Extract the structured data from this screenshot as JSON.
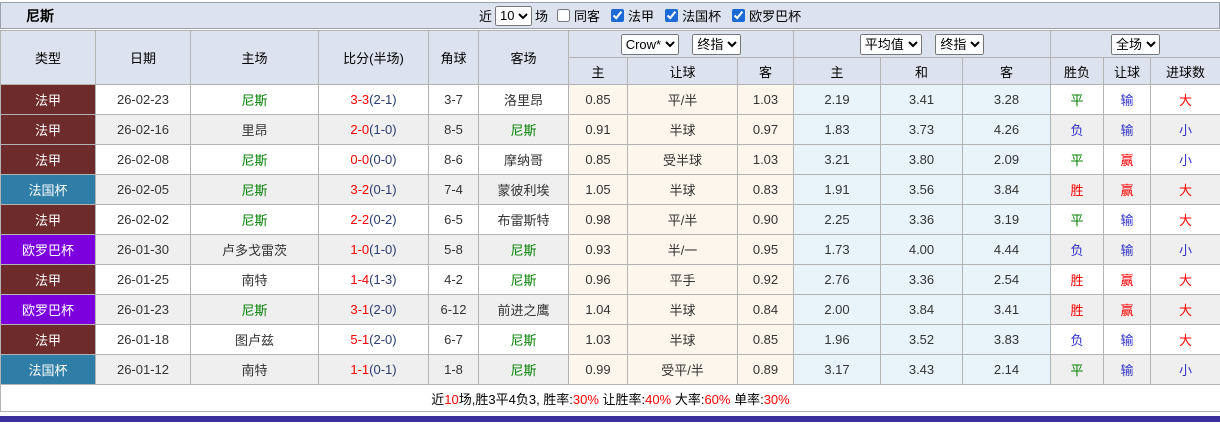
{
  "title": "尼斯",
  "toolbar": {
    "near_label": "近",
    "count_select": "10",
    "unit_label": "场",
    "same_away_label": "同客",
    "filters": [
      {
        "label": "法甲",
        "checked": true
      },
      {
        "label": "法国杯",
        "checked": true
      },
      {
        "label": "欧罗巴杯",
        "checked": true
      }
    ]
  },
  "header": {
    "cols": [
      "类型",
      "日期",
      "主场",
      "比分(半场)",
      "角球",
      "客场"
    ],
    "odds1": {
      "select1": "Crow*",
      "select2": "终指"
    },
    "odds2": {
      "select1": "平均值",
      "select2": "终指"
    },
    "scope_select": "全场",
    "sub": [
      "主",
      "让球",
      "客",
      "主",
      "和",
      "客",
      "胜负",
      "让球",
      "进球数"
    ]
  },
  "rows": [
    {
      "league": "法甲",
      "date": "26-02-23",
      "home": "尼斯",
      "score": "3-3",
      "half": "(2-1)",
      "corner": "3-7",
      "away": "洛里昂",
      "crow_home": "0.85",
      "crow_hcp": "平/半",
      "crow_away": "1.03",
      "avg_home": "2.19",
      "avg_draw": "3.41",
      "avg_away": "3.28",
      "result": "平",
      "hcp_result": "输",
      "goals": "大"
    },
    {
      "league": "法甲",
      "date": "26-02-16",
      "home": "里昂",
      "score": "2-0",
      "half": "(1-0)",
      "corner": "8-5",
      "away": "尼斯",
      "crow_home": "0.91",
      "crow_hcp": "半球",
      "crow_away": "0.97",
      "avg_home": "1.83",
      "avg_draw": "3.73",
      "avg_away": "4.26",
      "result": "负",
      "hcp_result": "输",
      "goals": "小"
    },
    {
      "league": "法甲",
      "date": "26-02-08",
      "home": "尼斯",
      "score": "0-0",
      "half": "(0-0)",
      "corner": "8-6",
      "away": "摩纳哥",
      "crow_home": "0.85",
      "crow_hcp": "受半球",
      "crow_away": "1.03",
      "avg_home": "3.21",
      "avg_draw": "3.80",
      "avg_away": "2.09",
      "result": "平",
      "hcp_result": "赢",
      "goals": "小"
    },
    {
      "league": "法国杯",
      "date": "26-02-05",
      "home": "尼斯",
      "score": "3-2",
      "half": "(0-1)",
      "corner": "7-4",
      "away": "蒙彼利埃",
      "crow_home": "1.05",
      "crow_hcp": "半球",
      "crow_away": "0.83",
      "avg_home": "1.91",
      "avg_draw": "3.56",
      "avg_away": "3.84",
      "result": "胜",
      "hcp_result": "赢",
      "goals": "大"
    },
    {
      "league": "法甲",
      "date": "26-02-02",
      "home": "尼斯",
      "score": "2-2",
      "half": "(0-2)",
      "corner": "6-5",
      "away": "布雷斯特",
      "crow_home": "0.98",
      "crow_hcp": "平/半",
      "crow_away": "0.90",
      "avg_home": "2.25",
      "avg_draw": "3.36",
      "avg_away": "3.19",
      "result": "平",
      "hcp_result": "输",
      "goals": "大"
    },
    {
      "league": "欧罗巴杯",
      "date": "26-01-30",
      "home": "卢多戈雷茨",
      "score": "1-0",
      "half": "(1-0)",
      "corner": "5-8",
      "away": "尼斯",
      "crow_home": "0.93",
      "crow_hcp": "半/一",
      "crow_away": "0.95",
      "avg_home": "1.73",
      "avg_draw": "4.00",
      "avg_away": "4.44",
      "result": "负",
      "hcp_result": "输",
      "goals": "小"
    },
    {
      "league": "法甲",
      "date": "26-01-25",
      "home": "南特",
      "score": "1-4",
      "half": "(1-3)",
      "corner": "4-2",
      "away": "尼斯",
      "crow_home": "0.96",
      "crow_hcp": "平手",
      "crow_away": "0.92",
      "avg_home": "2.76",
      "avg_draw": "3.36",
      "avg_away": "2.54",
      "result": "胜",
      "hcp_result": "赢",
      "goals": "大"
    },
    {
      "league": "欧罗巴杯",
      "date": "26-01-23",
      "home": "尼斯",
      "score": "3-1",
      "half": "(2-0)",
      "corner": "6-12",
      "away": "前进之鹰",
      "crow_home": "1.04",
      "crow_hcp": "半球",
      "crow_away": "0.84",
      "avg_home": "2.00",
      "avg_draw": "3.84",
      "avg_away": "3.41",
      "result": "胜",
      "hcp_result": "赢",
      "goals": "大"
    },
    {
      "league": "法甲",
      "date": "26-01-18",
      "home": "图卢兹",
      "score": "5-1",
      "half": "(2-0)",
      "corner": "6-7",
      "away": "尼斯",
      "crow_home": "1.03",
      "crow_hcp": "半球",
      "crow_away": "0.85",
      "avg_home": "1.96",
      "avg_draw": "3.52",
      "avg_away": "3.83",
      "result": "负",
      "hcp_result": "输",
      "goals": "大"
    },
    {
      "league": "法国杯",
      "date": "26-01-12",
      "home": "南特",
      "score": "1-1",
      "half": "(0-1)",
      "corner": "1-8",
      "away": "尼斯",
      "crow_home": "0.99",
      "crow_hcp": "受平/半",
      "crow_away": "0.89",
      "avg_home": "3.17",
      "avg_draw": "3.43",
      "avg_away": "2.14",
      "result": "平",
      "hcp_result": "输",
      "goals": "小"
    }
  ],
  "summary": {
    "segments": [
      {
        "text": "近",
        "color": "black"
      },
      {
        "text": "10",
        "color": "red"
      },
      {
        "text": "场,胜3平4负3, 胜率:",
        "color": "black"
      },
      {
        "text": "30%",
        "color": "red"
      },
      {
        "text": " 让胜率:",
        "color": "black"
      },
      {
        "text": "40%",
        "color": "red"
      },
      {
        "text": " 大率:",
        "color": "black"
      },
      {
        "text": "60%",
        "color": "red"
      },
      {
        "text": " 单率:",
        "color": "black"
      },
      {
        "text": "30%",
        "color": "red"
      }
    ]
  },
  "colors": {
    "league_ligue1": "#6e2b2b",
    "league_coupe_de_france": "#2e7ea8",
    "league_europa": "#7c00de",
    "crow_odds_bg": "#fdf6ec",
    "avg_odds_bg": "#e8f4fa",
    "win_red": "#fe0000",
    "lose_blue": "#3232cd",
    "draw_green": "#008000",
    "header_bg": "#dce3ee",
    "bottom_bar": "#3c319c"
  }
}
